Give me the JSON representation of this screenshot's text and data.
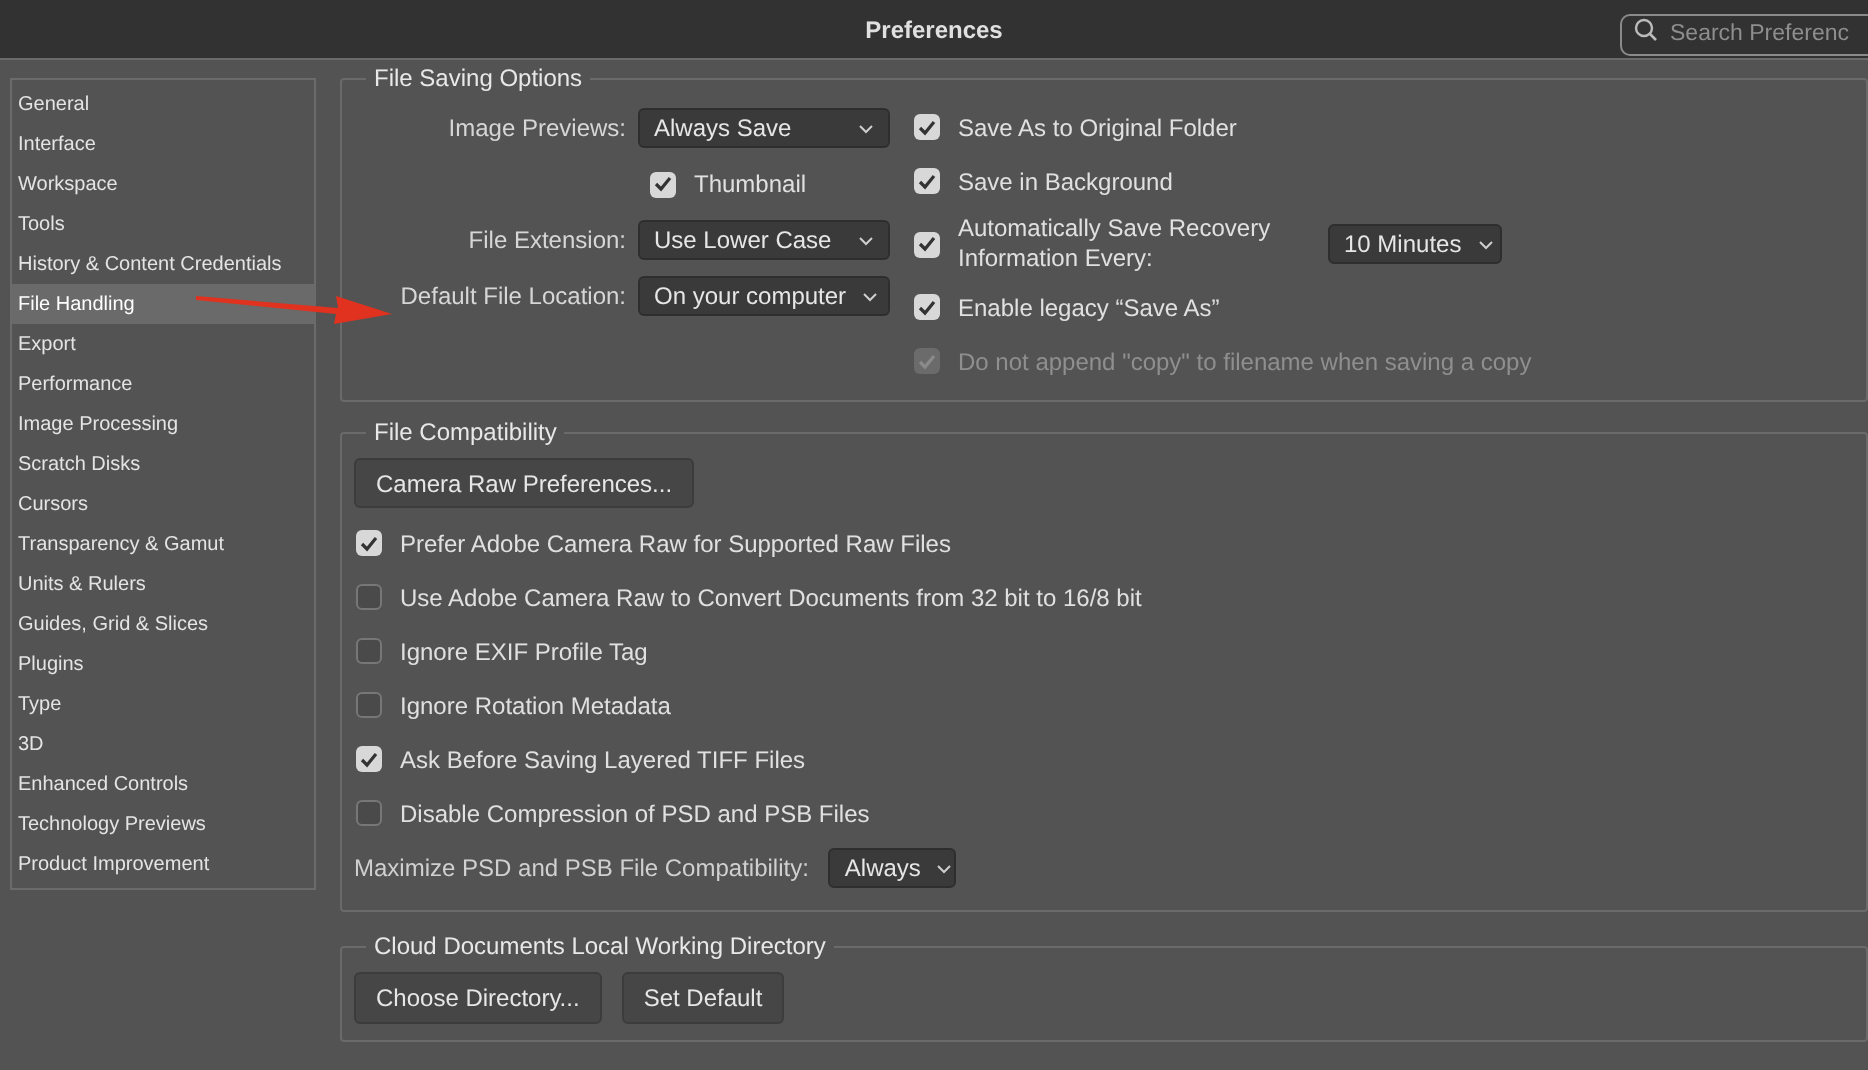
{
  "window": {
    "title": "Preferences"
  },
  "search": {
    "placeholder": "Search Preferenc"
  },
  "sidebar": {
    "items": [
      {
        "label": "General",
        "selected": false
      },
      {
        "label": "Interface",
        "selected": false
      },
      {
        "label": "Workspace",
        "selected": false
      },
      {
        "label": "Tools",
        "selected": false
      },
      {
        "label": "History & Content Credentials",
        "selected": false
      },
      {
        "label": "File Handling",
        "selected": true
      },
      {
        "label": "Export",
        "selected": false
      },
      {
        "label": "Performance",
        "selected": false
      },
      {
        "label": "Image Processing",
        "selected": false
      },
      {
        "label": "Scratch Disks",
        "selected": false
      },
      {
        "label": "Cursors",
        "selected": false
      },
      {
        "label": "Transparency & Gamut",
        "selected": false
      },
      {
        "label": "Units & Rulers",
        "selected": false
      },
      {
        "label": "Guides, Grid & Slices",
        "selected": false
      },
      {
        "label": "Plugins",
        "selected": false
      },
      {
        "label": "Type",
        "selected": false
      },
      {
        "label": "3D",
        "selected": false
      },
      {
        "label": "Enhanced Controls",
        "selected": false
      },
      {
        "label": "Technology Previews",
        "selected": false
      },
      {
        "label": "Product Improvement",
        "selected": false
      }
    ]
  },
  "file_saving_options": {
    "title": "File Saving Options",
    "left": [
      {
        "kind": "select",
        "label": "Image Previews:",
        "value": "Always Save"
      },
      {
        "kind": "checkbox",
        "label": "Thumbnail",
        "checked": true
      },
      {
        "kind": "select",
        "label": "File Extension:",
        "value": "Use Lower Case"
      },
      {
        "kind": "select",
        "label": "Default File Location:",
        "value": "On your computer"
      }
    ],
    "right": [
      {
        "label": "Save As to Original Folder",
        "checked": true,
        "disabled": false
      },
      {
        "label": "Save in Background",
        "checked": true,
        "disabled": false
      },
      {
        "label": "Automatically Save Recovery Information Every:",
        "checked": true,
        "disabled": false,
        "select_value": "10 Minutes"
      },
      {
        "label": "Enable legacy “Save As”",
        "checked": true,
        "disabled": false
      },
      {
        "label": "Do not append \"copy\" to filename when saving a copy",
        "checked": true,
        "disabled": true
      }
    ]
  },
  "file_compatibility": {
    "title": "File Compatibility",
    "button": "Camera Raw Preferences...",
    "checkboxes": [
      {
        "label": "Prefer Adobe Camera Raw for Supported Raw Files",
        "checked": true
      },
      {
        "label": "Use Adobe Camera Raw to Convert Documents from 32 bit to 16/8 bit",
        "checked": false
      },
      {
        "label": "Ignore EXIF Profile Tag",
        "checked": false
      },
      {
        "label": "Ignore Rotation Metadata",
        "checked": false
      },
      {
        "label": "Ask Before Saving Layered TIFF Files",
        "checked": true
      },
      {
        "label": "Disable Compression of PSD and PSB Files",
        "checked": false
      }
    ],
    "maximize": {
      "label": "Maximize PSD and PSB File Compatibility:",
      "value": "Always"
    }
  },
  "cloud_documents": {
    "title": "Cloud Documents Local Working Directory",
    "buttons": [
      "Choose Directory...",
      "Set Default"
    ]
  }
}
